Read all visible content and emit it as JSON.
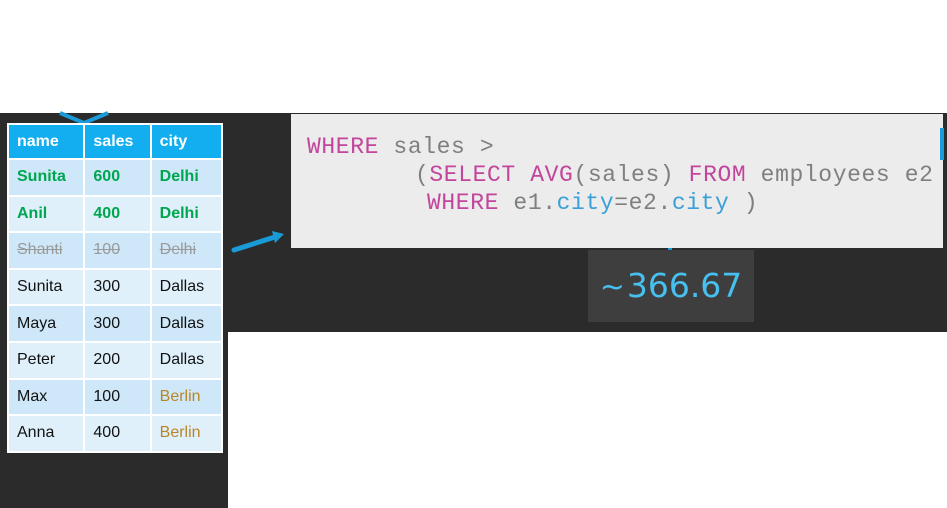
{
  "table": {
    "headers": [
      "name",
      "sales",
      "city"
    ],
    "rows": [
      {
        "name": "Sunita",
        "sales": "600",
        "city": "Delhi",
        "state": "highlighted"
      },
      {
        "name": "Anil",
        "sales": "400",
        "city": "Delhi",
        "state": "highlighted"
      },
      {
        "name": "Shanti",
        "sales": "100",
        "city": "Delhi",
        "state": "struck"
      },
      {
        "name": "Sunita",
        "sales": "300",
        "city": "Dallas",
        "state": "normal"
      },
      {
        "name": "Maya",
        "sales": "300",
        "city": "Dallas",
        "state": "normal"
      },
      {
        "name": "Peter",
        "sales": "200",
        "city": "Dallas",
        "state": "normal"
      },
      {
        "name": "Max",
        "sales": "100",
        "city": "Berlin",
        "state": "normal"
      },
      {
        "name": "Anna",
        "sales": "400",
        "city": "Berlin",
        "state": "normal"
      }
    ]
  },
  "code": {
    "line1": {
      "kw": "WHERE",
      "rest": " sales >"
    },
    "line2": {
      "open": "(",
      "select": "SELECT",
      "avg": "AVG",
      "args": "(sales) ",
      "from": "FROM",
      "rest": " employees e2"
    },
    "line3": {
      "where": "WHERE",
      "left": " e1.",
      "city1": "city",
      "eq": "=e2.",
      "city2": "city",
      "close": " )"
    }
  },
  "result": {
    "tilde": "~",
    "value": "366.67"
  },
  "colors": {
    "header_bg": "#12aef0",
    "keyword": "#c2449b",
    "column": "#3aa0d8",
    "highlight_green": "#00a64f",
    "berlin": "#b8862a",
    "result_text": "#47c0ef",
    "connector": "#1a9bd8"
  }
}
